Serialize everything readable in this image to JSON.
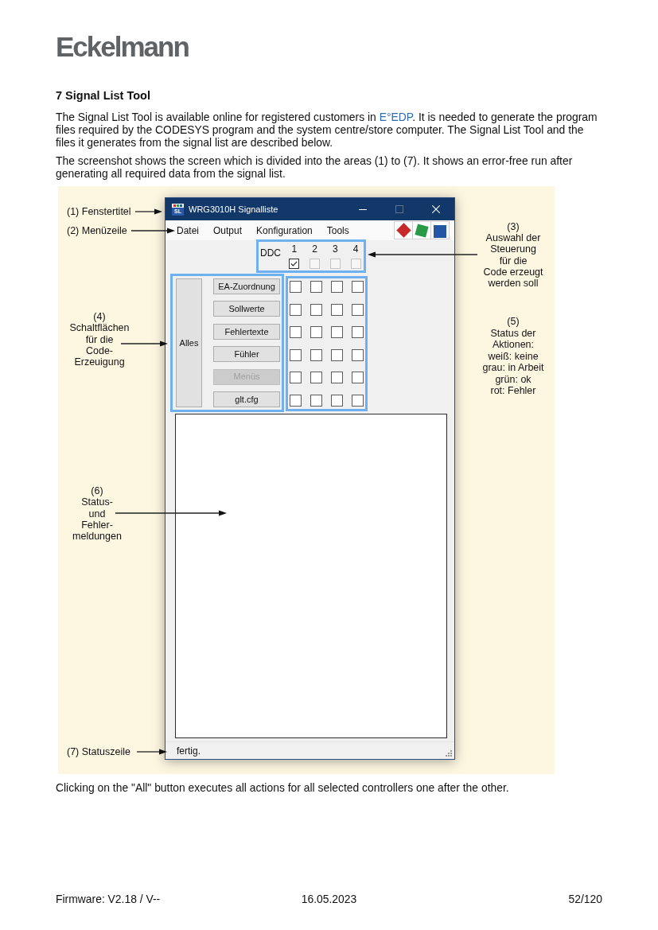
{
  "logo": "Eckelmann",
  "heading": "7 Signal List Tool",
  "intro": {
    "before": "The Signal List Tool is available online for registered customers in ",
    "link": "E°EDP",
    "after": ". It is needed to generate the program files required by the CODESYS program and the system centre/store computer. The Signal List Tool and the files it generates from the signal list are described below."
  },
  "description": "The screenshot shows the screen which is divided into the areas (1) to (7). It shows an error-free run after generating all required data from the signal list.",
  "figure": {
    "window": {
      "title": "WRG3010H Signalliste",
      "icon_label": "SL",
      "controls": [
        {
          "kind": "minimize",
          "disabled": false
        },
        {
          "kind": "maximize",
          "disabled": true
        },
        {
          "kind": "close",
          "disabled": false
        }
      ],
      "menu": [
        "Datei",
        "Output",
        "Konfiguration",
        "Tools"
      ],
      "toolbar": [
        {
          "kind": "diamond",
          "color": "#c8282a"
        },
        {
          "kind": "tilted",
          "color": "#2a9a46"
        },
        {
          "kind": "square",
          "color": "#2356a3"
        }
      ],
      "ddc": {
        "label": "DDC",
        "controllers": [
          {
            "number": "1",
            "checked": true,
            "disabled": false
          },
          {
            "number": "2",
            "checked": false,
            "disabled": true
          },
          {
            "number": "3",
            "checked": false,
            "disabled": true
          },
          {
            "number": "4",
            "checked": false,
            "disabled": true
          }
        ]
      },
      "all_button": {
        "label": "Alles"
      },
      "action_buttons": [
        {
          "label": "EA-Zuordnung",
          "disabled": false
        },
        {
          "label": "Sollwerte",
          "disabled": false
        },
        {
          "label": "Fehlertexte",
          "disabled": false
        },
        {
          "label": "Fühler",
          "disabled": false
        },
        {
          "label": "Menüs",
          "disabled": true
        },
        {
          "label": "glt.cfg",
          "disabled": false
        }
      ],
      "status_grid": [
        [
          {
            "color": "#ffffff"
          },
          {
            "color": "#ffffff"
          },
          {
            "color": "#ffffff"
          },
          {
            "color": "#ffffff"
          }
        ],
        [
          {
            "color": "#ffffff"
          },
          {
            "color": "#ffffff"
          },
          {
            "color": "#ffffff"
          },
          {
            "color": "#ffffff"
          }
        ],
        [
          {
            "color": "#ffffff"
          },
          {
            "color": "#ffffff"
          },
          {
            "color": "#ffffff"
          },
          {
            "color": "#ffffff"
          }
        ],
        [
          {
            "color": "#ffffff"
          },
          {
            "color": "#ffffff"
          },
          {
            "color": "#ffffff"
          },
          {
            "color": "#ffffff"
          }
        ],
        [
          {
            "color": "#ffffff"
          },
          {
            "color": "#ffffff"
          },
          {
            "color": "#ffffff"
          },
          {
            "color": "#ffffff"
          }
        ],
        [
          {
            "color": "#ffffff"
          },
          {
            "color": "#ffffff"
          },
          {
            "color": "#ffffff"
          },
          {
            "color": "#ffffff"
          }
        ]
      ],
      "status_bar": "fertig."
    },
    "annotations": [
      {
        "lines": [
          "(1) Fenstertitel"
        ]
      },
      {
        "lines": [
          "(2) Menüzeile"
        ]
      },
      {
        "lines": [
          "(3)",
          "Auswahl der",
          "Steuerung",
          "für die",
          "Code erzeugt",
          "werden soll"
        ]
      },
      {
        "lines": [
          "(4)",
          "Schaltflächen",
          "für die",
          "Code-",
          "Erzeuigung"
        ]
      },
      {
        "lines": [
          "(5)",
          "Status der",
          "Aktionen:",
          "weiß: keine",
          "grau: in Arbeit",
          "grün: ok",
          "rot: Fehler"
        ]
      },
      {
        "lines": [
          "(6)",
          "Status-",
          "und",
          "Fehler-",
          "meldungen"
        ]
      },
      {
        "lines": [
          "(7) Statuszeile"
        ]
      }
    ]
  },
  "closing": "Clicking on the \"All\" button executes all actions for all selected controllers one after the other.",
  "footer": {
    "left": "Firmware: V2.18 / V--",
    "center": "16.05.2023",
    "right": "52/120"
  }
}
